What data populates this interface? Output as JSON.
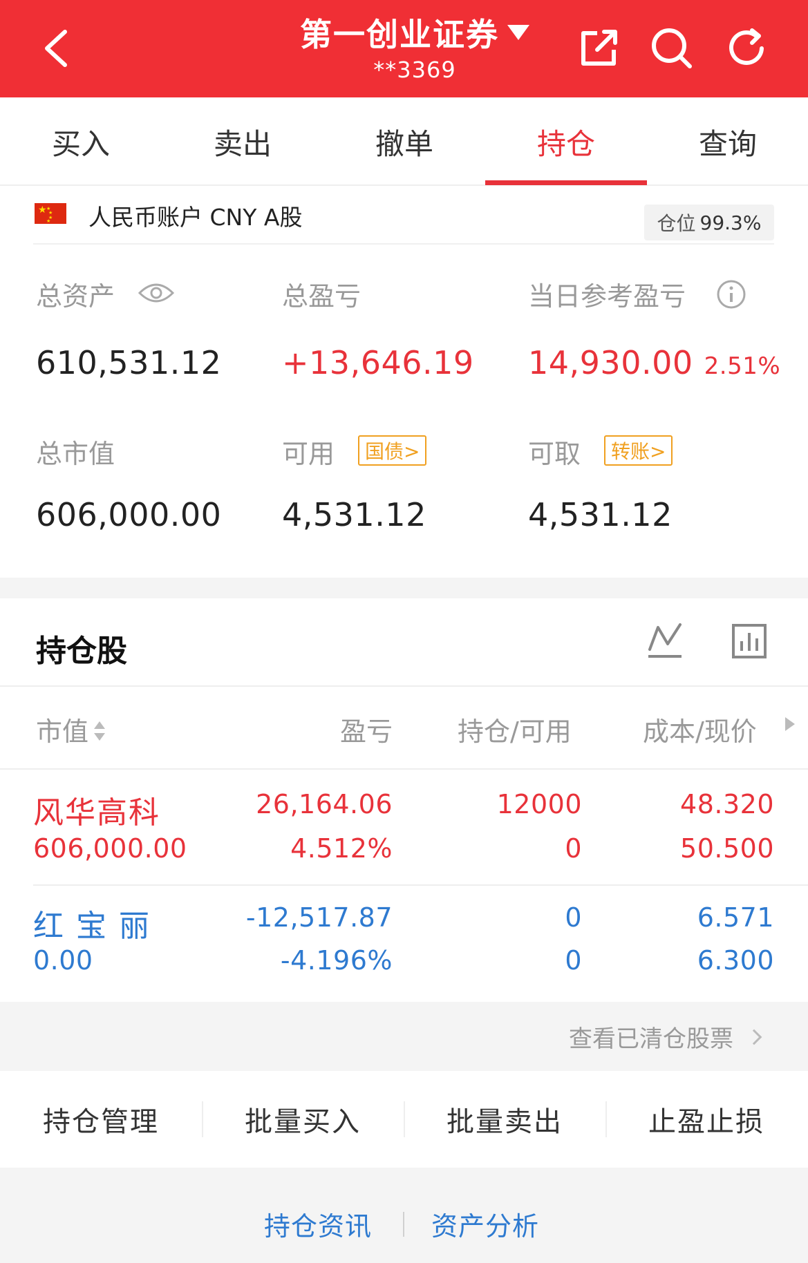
{
  "header": {
    "title": "第一创业证券",
    "subtitle": "**3369",
    "icons": [
      "back-icon",
      "dropdown-caret-icon",
      "share-icon",
      "search-icon",
      "refresh-icon"
    ],
    "bg_color": "#f02f35"
  },
  "tabs": [
    {
      "label": "买入",
      "active": false
    },
    {
      "label": "卖出",
      "active": false
    },
    {
      "label": "撤单",
      "active": false
    },
    {
      "label": "持仓",
      "active": true
    },
    {
      "label": "查询",
      "active": false
    }
  ],
  "account": {
    "label": "人民币账户 CNY A股",
    "position_label": "仓位",
    "position_value": "99.3%"
  },
  "assets": {
    "total_assets_label": "总资产",
    "total_assets": "610,531.12",
    "total_pnl_label": "总盈亏",
    "total_pnl": "+13,646.19",
    "daily_pnl_label": "当日参考盈亏",
    "daily_pnl": "14,930.00",
    "daily_pnl_pct": "2.51%",
    "market_value_label": "总市值",
    "market_value": "606,000.00",
    "available_label": "可用",
    "available_tag": "国债>",
    "available": "4,531.12",
    "withdrawable_label": "可取",
    "withdrawable_tag": "转账>",
    "withdrawable": "4,531.12"
  },
  "holdings": {
    "title": "持仓股",
    "columns": [
      "市值",
      "盈亏",
      "持仓/可用",
      "成本/现价"
    ],
    "rows": [
      {
        "name": "风华高科",
        "market_value": "606,000.00",
        "pnl": "26,164.06",
        "pnl_pct": "4.512%",
        "position": "12000",
        "available": "0",
        "cost": "48.320",
        "price": "50.500",
        "color": "#e8323a"
      },
      {
        "name": "红 宝 丽",
        "market_value": "0.00",
        "pnl": "-12,517.87",
        "pnl_pct": "-4.196%",
        "position": "0",
        "available": "0",
        "cost": "6.571",
        "price": "6.300",
        "color": "#2e7ad0"
      }
    ],
    "cleared_link": "查看已清仓股票"
  },
  "actions": [
    "持仓管理",
    "批量买入",
    "批量卖出",
    "止盈止损"
  ],
  "footer": [
    "持仓资讯",
    "资产分析"
  ],
  "colors": {
    "red": "#e8323a",
    "blue": "#2e7ad0",
    "tag": "#f0a020"
  }
}
